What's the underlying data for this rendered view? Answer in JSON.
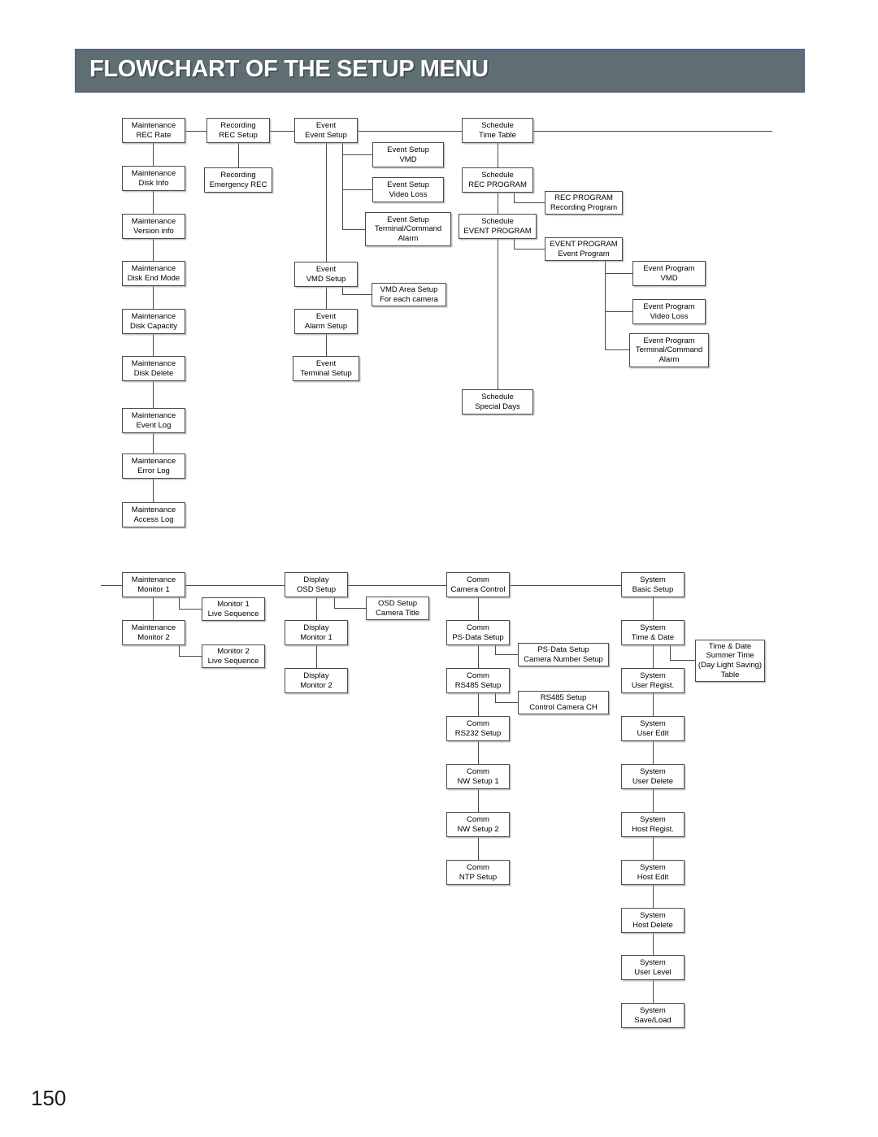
{
  "header": {
    "title": "FLOWCHART OF THE SETUP MENU",
    "band_color": "#5f6e72",
    "title_color": "#ffffff"
  },
  "page_number": "150",
  "chart_data": {
    "type": "diagram",
    "title": "FLOWCHART OF THE SETUP MENU",
    "notes": "Two-part hierarchical flowchart of DVR setup menu screens. Boxes contain a menu group name on line 1 and the screen name on following lines."
  },
  "diagram": {
    "section_top": {
      "columns": [
        {
          "name": "maintenance-column",
          "boxes": [
            {
              "id": "maint-rec-rate",
              "lines": [
                "Maintenance",
                "REC Rate"
              ]
            },
            {
              "id": "maint-disk-info",
              "lines": [
                "Maintenance",
                "Disk Info"
              ]
            },
            {
              "id": "maint-version-info",
              "lines": [
                "Maintenance",
                "Version info"
              ]
            },
            {
              "id": "maint-disk-end-mode",
              "lines": [
                "Maintenance",
                "Disk End Mode"
              ]
            },
            {
              "id": "maint-disk-capacity",
              "lines": [
                "Maintenance",
                "Disk Capacity"
              ]
            },
            {
              "id": "maint-disk-delete",
              "lines": [
                "Maintenance",
                "Disk Delete"
              ]
            },
            {
              "id": "maint-event-log",
              "lines": [
                "Maintenance",
                "Event Log"
              ]
            },
            {
              "id": "maint-error-log",
              "lines": [
                "Maintenance",
                "Error Log"
              ]
            },
            {
              "id": "maint-access-log",
              "lines": [
                "Maintenance",
                "Access Log"
              ]
            }
          ]
        },
        {
          "name": "recording-column",
          "boxes": [
            {
              "id": "rec-rec-setup",
              "lines": [
                "Recording",
                "REC Setup"
              ]
            },
            {
              "id": "rec-emergency-rec",
              "lines": [
                "Recording",
                "Emergency REC"
              ]
            }
          ]
        },
        {
          "name": "event-column",
          "boxes": [
            {
              "id": "event-event-setup",
              "lines": [
                "Event",
                "Event Setup"
              ]
            },
            {
              "id": "event-vmd-setup",
              "lines": [
                "Event",
                "VMD Setup"
              ]
            },
            {
              "id": "event-alarm-setup",
              "lines": [
                "Event",
                "Alarm Setup"
              ]
            },
            {
              "id": "event-terminal-setup",
              "lines": [
                "Event",
                "Terminal Setup"
              ]
            }
          ]
        },
        {
          "name": "event-setup-children",
          "boxes": [
            {
              "id": "es-vmd",
              "lines": [
                "Event Setup",
                "VMD"
              ]
            },
            {
              "id": "es-video-loss",
              "lines": [
                "Event Setup",
                "Video Loss"
              ]
            },
            {
              "id": "es-terminal",
              "lines": [
                "Event Setup",
                "Terminal/Command",
                "Alarm"
              ]
            },
            {
              "id": "vmd-area-setup",
              "lines": [
                "VMD Area Setup",
                "For each camera"
              ]
            }
          ]
        },
        {
          "name": "schedule-column",
          "boxes": [
            {
              "id": "sched-time-table",
              "lines": [
                "Schedule",
                "Time Table"
              ]
            },
            {
              "id": "sched-rec-program",
              "lines": [
                "Schedule",
                "REC PROGRAM"
              ]
            },
            {
              "id": "sched-event-program",
              "lines": [
                "Schedule",
                "EVENT PROGRAM"
              ]
            },
            {
              "id": "sched-special-days",
              "lines": [
                "Schedule",
                "Special Days"
              ]
            }
          ]
        },
        {
          "name": "program-column",
          "boxes": [
            {
              "id": "rec-program-recording",
              "lines": [
                "REC PROGRAM",
                "Recording Program"
              ]
            },
            {
              "id": "event-program-event",
              "lines": [
                "EVENT PROGRAM",
                "Event Program"
              ]
            }
          ]
        },
        {
          "name": "event-program-children",
          "boxes": [
            {
              "id": "ep-vmd",
              "lines": [
                "Event Program",
                "VMD"
              ]
            },
            {
              "id": "ep-video-loss",
              "lines": [
                "Event Program",
                "Video Loss"
              ]
            },
            {
              "id": "ep-terminal",
              "lines": [
                "Event Program",
                "Terminal/Command",
                "Alarm"
              ]
            }
          ]
        }
      ]
    },
    "section_bottom": {
      "columns": [
        {
          "name": "maintenance-monitor-column",
          "boxes": [
            {
              "id": "maint-monitor-1",
              "lines": [
                "Maintenance",
                "Monitor 1"
              ]
            },
            {
              "id": "maint-monitor-2",
              "lines": [
                "Maintenance",
                "Monitor 2"
              ]
            }
          ]
        },
        {
          "name": "monitor-live-sequence-column",
          "boxes": [
            {
              "id": "mon1-live-seq",
              "lines": [
                "Monitor 1",
                "Live Sequence"
              ]
            },
            {
              "id": "mon2-live-seq",
              "lines": [
                "Monitor 2",
                "Live Sequence"
              ]
            }
          ]
        },
        {
          "name": "display-column",
          "boxes": [
            {
              "id": "disp-osd-setup",
              "lines": [
                "Display",
                "OSD Setup"
              ]
            },
            {
              "id": "disp-monitor-1",
              "lines": [
                "Display",
                "Monitor 1"
              ]
            },
            {
              "id": "disp-monitor-2",
              "lines": [
                "Display",
                "Monitor 2"
              ]
            }
          ]
        },
        {
          "name": "osd-children-column",
          "boxes": [
            {
              "id": "osd-camera-title",
              "lines": [
                "OSD Setup",
                "Camera Title"
              ]
            }
          ]
        },
        {
          "name": "comm-column",
          "boxes": [
            {
              "id": "comm-camera-control",
              "lines": [
                "Comm",
                "Camera Control"
              ]
            },
            {
              "id": "comm-ps-data-setup",
              "lines": [
                "Comm",
                "PS·Data Setup"
              ]
            },
            {
              "id": "comm-rs485-setup",
              "lines": [
                "Comm",
                "RS485 Setup"
              ]
            },
            {
              "id": "comm-rs232-setup",
              "lines": [
                "Comm",
                "RS232 Setup"
              ]
            },
            {
              "id": "comm-nw-setup-1",
              "lines": [
                "Comm",
                "NW Setup 1"
              ]
            },
            {
              "id": "comm-nw-setup-2",
              "lines": [
                "Comm",
                "NW Setup 2"
              ]
            },
            {
              "id": "comm-ntp-setup",
              "lines": [
                "Comm",
                "NTP Setup"
              ]
            }
          ]
        },
        {
          "name": "comm-children-column",
          "boxes": [
            {
              "id": "psdata-camera-number",
              "lines": [
                "PS·Data Setup",
                "Camera Number Setup"
              ]
            },
            {
              "id": "rs485-control-camera",
              "lines": [
                "RS485 Setup",
                "Control Camera CH"
              ]
            }
          ]
        },
        {
          "name": "system-column",
          "boxes": [
            {
              "id": "sys-basic-setup",
              "lines": [
                "System",
                "Basic Setup"
              ]
            },
            {
              "id": "sys-time-date",
              "lines": [
                "System",
                "Time & Date"
              ]
            },
            {
              "id": "sys-user-regist",
              "lines": [
                "System",
                "User Regist."
              ]
            },
            {
              "id": "sys-user-edit",
              "lines": [
                "System",
                "User Edit"
              ]
            },
            {
              "id": "sys-user-delete",
              "lines": [
                "System",
                "User Delete"
              ]
            },
            {
              "id": "sys-host-regist",
              "lines": [
                "System",
                "Host Regist."
              ]
            },
            {
              "id": "sys-host-edit",
              "lines": [
                "System",
                "Host Edit"
              ]
            },
            {
              "id": "sys-host-delete",
              "lines": [
                "System",
                "Host Delete"
              ]
            },
            {
              "id": "sys-user-level",
              "lines": [
                "System",
                "User Level"
              ]
            },
            {
              "id": "sys-save-load",
              "lines": [
                "System",
                "Save/Load"
              ]
            }
          ]
        },
        {
          "name": "system-children-column",
          "boxes": [
            {
              "id": "time-date-summer",
              "lines": [
                "Time & Date",
                "Summer Time",
                "(Day Light Saving)",
                "Table"
              ]
            }
          ]
        }
      ]
    }
  }
}
